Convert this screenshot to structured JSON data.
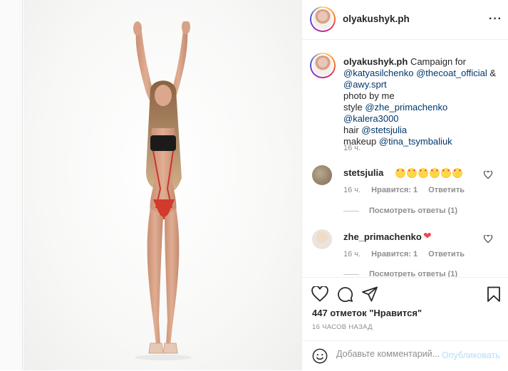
{
  "post": {
    "author": "olyakushyk.ph",
    "more_icon": "more-horizontal-icon"
  },
  "caption": {
    "username": "olyakushyk.ph",
    "line1_text": "Campaign for",
    "line2_m1": "@katyasilchenko",
    "line2_m2": "@thecoat_official",
    "line2_amp": "&",
    "line3_m": "@awy.sprt",
    "line4": "photo by me",
    "line5_prefix": "style",
    "line5_m1": "@zhe_primachenko",
    "line5_m2": "@kalera3000",
    "line6_prefix": "hair",
    "line6_m": "@stetsjulia",
    "line7_prefix": "makeup",
    "line7_m": "@tina_tsymbaliuk",
    "time": "16 ч."
  },
  "comments": [
    {
      "username": "stetsjulia",
      "emoji_count": 6,
      "emoji_name": "heart-eyes-emoji",
      "time": "16 ч.",
      "likes": "Нравится: 1",
      "reply": "Ответить",
      "view_replies": "Посмотреть ответы (1)"
    },
    {
      "username": "zhe_primachenko",
      "text": "❤",
      "time": "16 ч.",
      "likes": "Нравится: 1",
      "reply": "Ответить",
      "view_replies": "Посмотреть ответы (1)"
    }
  ],
  "actions": {
    "likes_text": "447 отметок \"Нравится\"",
    "time_ago": "16 ЧАСОВ НАЗАД",
    "comment_placeholder": "Добавьте комментарий...",
    "publish_label": "Опубликовать"
  },
  "colors": {
    "mention": "#00376b",
    "publish_disabled": "#b2dffc",
    "heart_red": "#ed4956"
  }
}
